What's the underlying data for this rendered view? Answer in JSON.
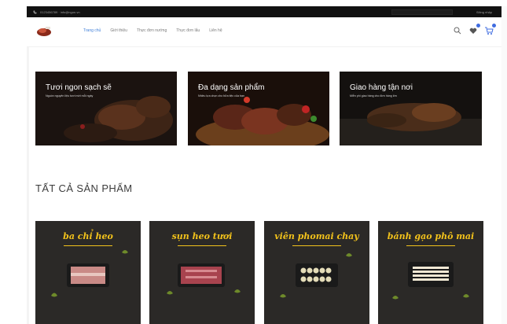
{
  "topbar": {
    "contact": "0123456789 · info@ngon.vn",
    "account": "Đăng nhập"
  },
  "header": {
    "nav": [
      "Trang chủ",
      "Giới thiệu",
      "Thực đơn nướng",
      "Thực đơn lẩu",
      "Liên hệ"
    ]
  },
  "banners": [
    {
      "title": "Tươi ngon sạch sẽ",
      "sub": "Nguồn nguyên liệu tươi mới mỗi ngày"
    },
    {
      "title": "Đa dạng sản phẩm",
      "sub": "Nhiều lựa chọn cho bữa tiệc của bạn"
    },
    {
      "title": "Giao hàng tận nơi",
      "sub": "Miễn phí giao hàng cho đơn hàng lớn"
    }
  ],
  "section": {
    "title": "TẤT CẢ SẢN PHẨM"
  },
  "products": [
    {
      "name": "ba chỉ heo"
    },
    {
      "name": "sụn heo tươi"
    },
    {
      "name": "viên phomai chay"
    },
    {
      "name": "bánh gạo phô mai"
    }
  ],
  "colors": {
    "accent": "#3f7fd9",
    "gold": "#f2c21b",
    "topbar": "#111111"
  }
}
